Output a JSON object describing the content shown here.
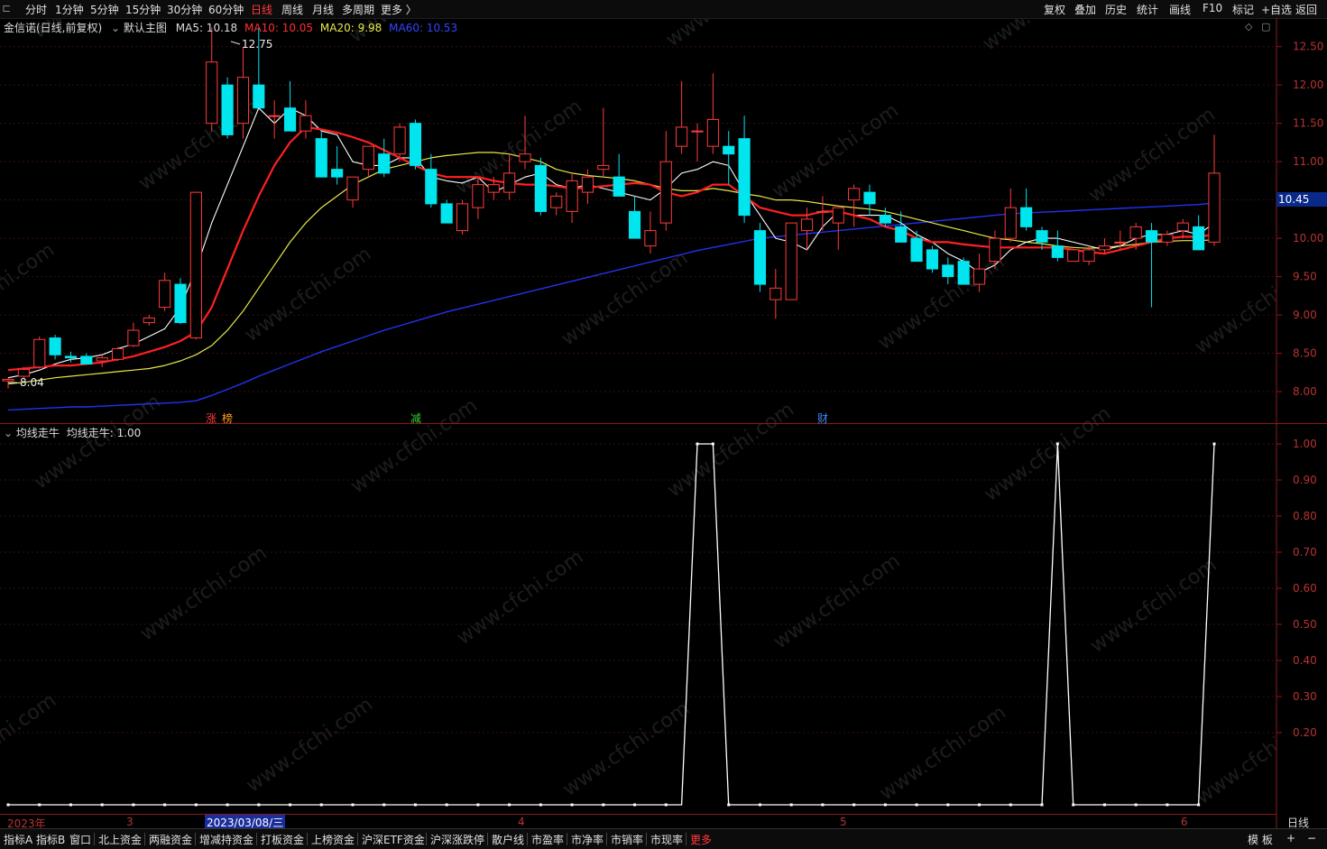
{
  "topbar": {
    "tabs": [
      "分时",
      "1分钟",
      "5分钟",
      "15分钟",
      "30分钟",
      "60分钟",
      "日线",
      "周线",
      "月线",
      "多周期",
      "更多 〉"
    ],
    "active_tab": "日线",
    "right_buttons": [
      "复权",
      "叠加",
      "历史",
      "统计",
      "画线",
      "F10",
      "标记",
      "+自选",
      "返回"
    ]
  },
  "chart_header": {
    "stock": "金信诺(日线,前复权)",
    "template": "默认主图",
    "ma5": "MA5: 10.18",
    "ma10": "MA10: 10.05",
    "ma20": "MA20: 9.98",
    "ma60": "MA60: 10.53"
  },
  "indicator_header": {
    "name": "均线走牛",
    "value": "均线走牛: 1.00"
  },
  "price_axis": [
    "12.50",
    "12.00",
    "11.50",
    "11.00",
    "10.50",
    "10.00",
    "9.50",
    "9.00",
    "8.50",
    "8.00"
  ],
  "current_price_tag": "10.45",
  "high_label": "12.75",
  "low_label": "8.04",
  "events": [
    {
      "text": "涨",
      "color": "#ff3b3b"
    },
    {
      "text": "榜",
      "color": "#ff9f1a"
    },
    {
      "text": "减",
      "color": "#33d433"
    },
    {
      "text": "财",
      "color": "#3a8bff"
    }
  ],
  "indicator_axis": [
    "1.00",
    "0.90",
    "0.80",
    "0.70",
    "0.60",
    "0.50",
    "0.40",
    "0.30",
    "0.20"
  ],
  "date_axis": {
    "year": "2023年",
    "months": [
      "3",
      "4",
      "5",
      "6"
    ],
    "cursor_date": "2023/03/08/三",
    "period": "日线"
  },
  "bottombar": {
    "items": [
      "指标A",
      "指标B",
      "窗口",
      "北上资金",
      "两融资金",
      "增减持资金",
      "打板资金",
      "上榜资金",
      "沪深ETF资金",
      "沪深涨跌停",
      "散户线",
      "市盈率",
      "市净率",
      "市销率",
      "市现率",
      "更多"
    ],
    "right": [
      "模 板",
      "+",
      "−"
    ]
  },
  "colors": {
    "up": "#ff3b3b",
    "down": "#00e5ee",
    "ma5": "#ffffff",
    "ma10": "#ff2020",
    "ma20": "#e8e84a",
    "ma60": "#2233ee"
  },
  "chart_data": {
    "type": "candlestick",
    "ohlc": [
      [
        8.14,
        8.18,
        8.04,
        8.16
      ],
      [
        8.2,
        8.32,
        8.16,
        8.29
      ],
      [
        8.32,
        8.72,
        8.3,
        8.68
      ],
      [
        8.7,
        8.74,
        8.42,
        8.48
      ],
      [
        8.46,
        8.52,
        8.38,
        8.44
      ],
      [
        8.46,
        8.5,
        8.4,
        8.36
      ],
      [
        8.4,
        8.48,
        8.32,
        8.44
      ],
      [
        8.42,
        8.58,
        8.4,
        8.56
      ],
      [
        8.6,
        8.9,
        8.58,
        8.8
      ],
      [
        8.9,
        9.0,
        8.86,
        8.96
      ],
      [
        9.1,
        9.55,
        9.05,
        9.45
      ],
      [
        9.4,
        9.48,
        8.88,
        8.9
      ],
      [
        8.7,
        10.6,
        8.68,
        10.6
      ],
      [
        11.5,
        12.75,
        11.4,
        12.3
      ],
      [
        12.0,
        12.1,
        11.3,
        11.35
      ],
      [
        11.5,
        12.5,
        11.3,
        12.1
      ],
      [
        12.0,
        12.75,
        11.8,
        11.7
      ],
      [
        11.6,
        11.8,
        11.3,
        11.6
      ],
      [
        11.7,
        12.05,
        11.4,
        11.4
      ],
      [
        11.4,
        11.8,
        11.3,
        11.6
      ],
      [
        11.3,
        11.4,
        10.8,
        10.8
      ],
      [
        10.9,
        11.2,
        10.7,
        10.8
      ],
      [
        10.5,
        10.8,
        10.4,
        10.8
      ],
      [
        10.9,
        11.2,
        10.8,
        11.2
      ],
      [
        11.1,
        11.3,
        10.8,
        10.85
      ],
      [
        11.1,
        11.5,
        11.0,
        11.45
      ],
      [
        11.5,
        11.55,
        10.9,
        10.95
      ],
      [
        10.9,
        11.1,
        10.4,
        10.45
      ],
      [
        10.45,
        10.5,
        10.2,
        10.2
      ],
      [
        10.1,
        10.5,
        10.05,
        10.45
      ],
      [
        10.4,
        10.8,
        10.25,
        10.7
      ],
      [
        10.6,
        10.8,
        10.5,
        10.7
      ],
      [
        10.6,
        11.1,
        10.5,
        10.85
      ],
      [
        11.0,
        11.6,
        10.9,
        11.1
      ],
      [
        10.95,
        11.05,
        10.3,
        10.35
      ],
      [
        10.4,
        10.6,
        10.3,
        10.55
      ],
      [
        10.35,
        10.85,
        10.2,
        10.75
      ],
      [
        10.6,
        10.9,
        10.45,
        10.8
      ],
      [
        10.9,
        11.7,
        10.8,
        10.95
      ],
      [
        10.8,
        11.1,
        10.6,
        10.55
      ],
      [
        10.35,
        10.55,
        10.1,
        10.0
      ],
      [
        9.9,
        10.35,
        9.8,
        10.1
      ],
      [
        10.2,
        11.4,
        10.1,
        11.0
      ],
      [
        11.2,
        12.05,
        11.1,
        11.45
      ],
      [
        11.4,
        11.5,
        11.0,
        11.4
      ],
      [
        11.2,
        12.15,
        11.1,
        11.55
      ],
      [
        11.2,
        11.4,
        10.7,
        11.1
      ],
      [
        11.3,
        11.6,
        10.2,
        10.3
      ],
      [
        10.1,
        10.2,
        9.3,
        9.4
      ],
      [
        9.2,
        9.6,
        8.95,
        9.35
      ],
      [
        9.2,
        10.2,
        9.2,
        10.2
      ],
      [
        10.1,
        10.4,
        9.85,
        10.25
      ],
      [
        10.35,
        10.55,
        10.1,
        10.35
      ],
      [
        10.2,
        10.4,
        9.85,
        10.4
      ],
      [
        10.5,
        10.7,
        10.15,
        10.65
      ],
      [
        10.6,
        10.7,
        10.3,
        10.45
      ],
      [
        10.3,
        10.4,
        10.15,
        10.2
      ],
      [
        10.15,
        10.35,
        9.95,
        9.95
      ],
      [
        10.0,
        10.1,
        9.8,
        9.7
      ],
      [
        9.85,
        9.9,
        9.55,
        9.6
      ],
      [
        9.65,
        9.75,
        9.4,
        9.5
      ],
      [
        9.7,
        9.75,
        9.4,
        9.4
      ],
      [
        9.4,
        9.8,
        9.3,
        9.6
      ],
      [
        9.7,
        10.1,
        9.6,
        10.0
      ],
      [
        10.0,
        10.65,
        9.95,
        10.4
      ],
      [
        10.4,
        10.65,
        10.1,
        10.15
      ],
      [
        10.1,
        10.15,
        9.85,
        9.95
      ],
      [
        9.9,
        10.1,
        9.7,
        9.75
      ],
      [
        9.7,
        9.85,
        9.7,
        9.85
      ],
      [
        9.7,
        9.9,
        9.65,
        9.85
      ],
      [
        9.85,
        10.0,
        9.8,
        9.9
      ],
      [
        9.95,
        10.1,
        9.85,
        9.95
      ],
      [
        10.0,
        10.2,
        9.85,
        10.15
      ],
      [
        10.1,
        10.2,
        9.1,
        9.95
      ],
      [
        9.95,
        10.1,
        9.9,
        10.05
      ],
      [
        10.1,
        10.25,
        10.0,
        10.2
      ],
      [
        10.15,
        10.3,
        9.85,
        9.85
      ],
      [
        9.95,
        11.35,
        9.9,
        10.85
      ]
    ],
    "ma5": [
      8.18,
      8.22,
      8.28,
      8.36,
      8.42,
      8.44,
      8.48,
      8.56,
      8.62,
      8.72,
      8.82,
      9.1,
      9.6,
      10.2,
      10.7,
      11.2,
      11.7,
      11.5,
      11.7,
      11.6,
      11.4,
      11.35,
      11.0,
      10.95,
      10.95,
      11.05,
      11.05,
      10.8,
      10.75,
      10.72,
      10.8,
      10.6,
      10.7,
      10.8,
      10.85,
      10.7,
      10.65,
      10.7,
      10.65,
      10.6,
      10.55,
      10.5,
      10.65,
      10.85,
      10.9,
      11.0,
      10.95,
      10.6,
      10.3,
      10.0,
      9.95,
      9.85,
      10.15,
      10.35,
      10.3,
      10.3,
      10.3,
      10.2,
      10.05,
      9.95,
      9.8,
      9.7,
      9.55,
      9.65,
      9.85,
      9.95,
      10.0,
      10.0,
      9.95,
      9.9,
      9.85,
      9.9,
      10.0,
      10.05,
      10.05,
      10.1,
      10.05,
      10.2
    ],
    "ma10": [
      8.28,
      8.3,
      8.32,
      8.34,
      8.34,
      8.36,
      8.38,
      8.42,
      8.46,
      8.52,
      8.58,
      8.66,
      8.78,
      9.1,
      9.6,
      10.1,
      10.55,
      10.95,
      11.25,
      11.45,
      11.42,
      11.38,
      11.32,
      11.25,
      11.15,
      11.05,
      10.95,
      10.85,
      10.8,
      10.8,
      10.8,
      10.75,
      10.72,
      10.7,
      10.7,
      10.68,
      10.65,
      10.66,
      10.68,
      10.7,
      10.72,
      10.7,
      10.6,
      10.55,
      10.6,
      10.7,
      10.7,
      10.55,
      10.4,
      10.35,
      10.3,
      10.3,
      10.35,
      10.35,
      10.3,
      10.25,
      10.15,
      10.1,
      10.0,
      9.95,
      9.95,
      9.92,
      9.9,
      9.88,
      9.88,
      9.88,
      9.88,
      9.88,
      9.85,
      9.82,
      9.8,
      9.85,
      9.9,
      9.95,
      10.0,
      10.02,
      10.02,
      10.05
    ],
    "ma20": [
      8.1,
      8.12,
      8.15,
      8.18,
      8.2,
      8.22,
      8.24,
      8.26,
      8.28,
      8.3,
      8.34,
      8.4,
      8.48,
      8.6,
      8.8,
      9.05,
      9.35,
      9.65,
      9.95,
      10.2,
      10.4,
      10.55,
      10.7,
      10.8,
      10.9,
      10.95,
      11.0,
      11.05,
      11.08,
      11.1,
      11.12,
      11.12,
      11.1,
      11.05,
      11.0,
      10.9,
      10.85,
      10.82,
      10.8,
      10.78,
      10.75,
      10.7,
      10.65,
      10.62,
      10.62,
      10.65,
      10.62,
      10.58,
      10.55,
      10.5,
      10.5,
      10.48,
      10.45,
      10.42,
      10.4,
      10.38,
      10.35,
      10.3,
      10.25,
      10.2,
      10.15,
      10.1,
      10.05,
      10.0,
      9.98,
      9.95,
      9.93,
      9.9,
      9.88,
      9.87,
      9.88,
      9.9,
      9.92,
      9.95,
      9.96,
      9.97,
      9.97,
      9.98
    ],
    "ma60": [
      7.76,
      7.77,
      7.78,
      7.79,
      7.8,
      7.8,
      7.81,
      7.82,
      7.83,
      7.84,
      7.85,
      7.86,
      7.88,
      7.95,
      8.03,
      8.11,
      8.2,
      8.28,
      8.36,
      8.44,
      8.52,
      8.59,
      8.66,
      8.73,
      8.8,
      8.86,
      8.92,
      8.98,
      9.04,
      9.09,
      9.14,
      9.19,
      9.24,
      9.29,
      9.34,
      9.39,
      9.44,
      9.49,
      9.54,
      9.59,
      9.64,
      9.69,
      9.74,
      9.79,
      9.84,
      9.88,
      9.92,
      9.96,
      10.0,
      10.02,
      10.04,
      10.06,
      10.08,
      10.1,
      10.12,
      10.14,
      10.16,
      10.18,
      10.2,
      10.22,
      10.24,
      10.26,
      10.28,
      10.3,
      10.32,
      10.33,
      10.34,
      10.35,
      10.36,
      10.37,
      10.38,
      10.39,
      10.4,
      10.41,
      10.42,
      10.43,
      10.44,
      10.46
    ],
    "indicator": [
      0,
      0,
      0,
      0,
      0,
      0,
      0,
      0,
      0,
      0,
      0,
      0,
      0,
      0,
      0,
      0,
      0,
      0,
      0,
      0,
      0,
      0,
      0,
      0,
      0,
      0,
      0,
      0,
      0,
      0,
      0,
      0,
      0,
      0,
      0,
      0,
      0,
      0,
      0,
      0,
      0,
      0,
      0,
      0,
      1,
      1,
      0,
      0,
      0,
      0,
      0,
      0,
      0,
      0,
      0,
      0,
      0,
      0,
      0,
      0,
      0,
      0,
      0,
      0,
      0,
      0,
      0,
      1,
      0,
      0,
      0,
      0,
      0,
      0,
      0,
      0,
      0,
      1
    ],
    "ylim_price": [
      7.6,
      12.85
    ],
    "ylim_indicator": [
      0,
      1
    ]
  }
}
